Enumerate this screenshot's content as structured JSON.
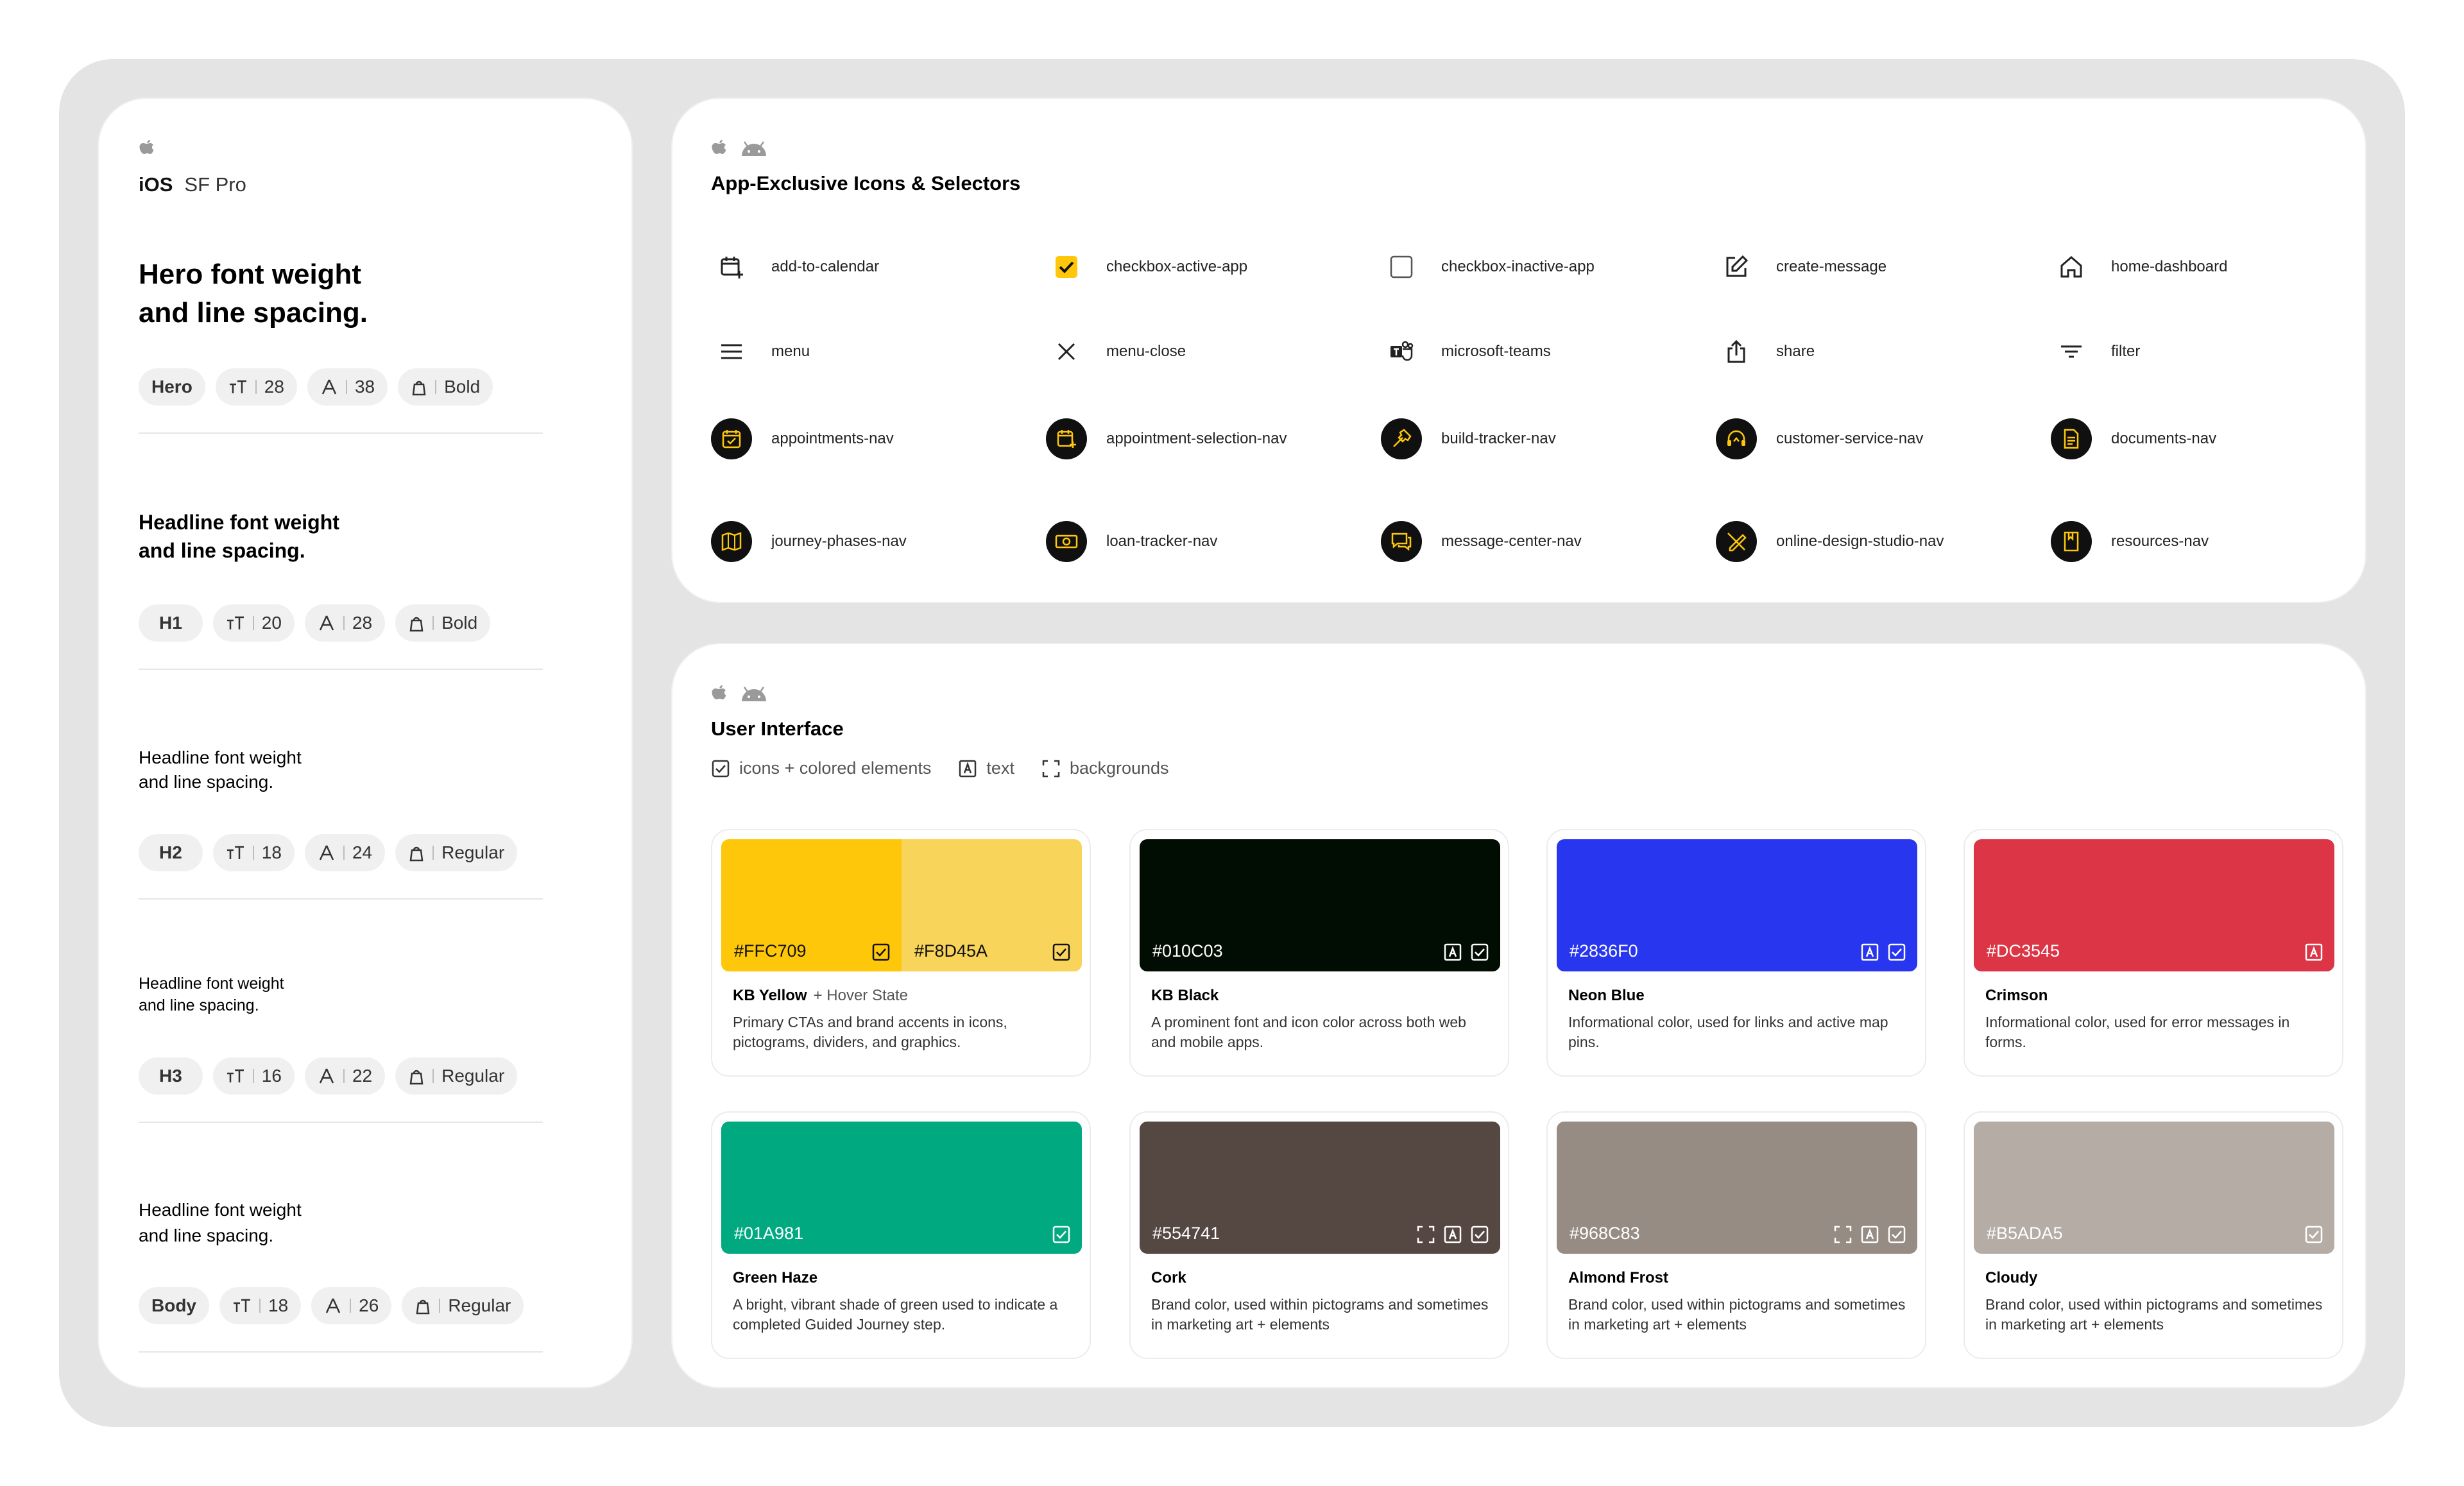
{
  "typography": {
    "platform_name": "iOS",
    "font_name": "SF Pro",
    "styles": [
      {
        "sample_line1": "Hero font weight",
        "sample_line2": "and line spacing.",
        "name": "Hero",
        "size": "28",
        "line_height": "38",
        "weight": "Bold"
      },
      {
        "sample_line1": "Headline font weight",
        "sample_line2": "and line spacing.",
        "name": "H1",
        "size": "20",
        "line_height": "28",
        "weight": "Bold"
      },
      {
        "sample_line1": "Headline font weight",
        "sample_line2": "and line spacing.",
        "name": "H2",
        "size": "18",
        "line_height": "24",
        "weight": "Regular"
      },
      {
        "sample_line1": "Headline font weight",
        "sample_line2": "and line spacing.",
        "name": "H3",
        "size": "16",
        "line_height": "22",
        "weight": "Regular"
      },
      {
        "sample_line1": "Headline font weight",
        "sample_line2": "and line spacing.",
        "name": "Body",
        "size": "18",
        "line_height": "26",
        "weight": "Regular"
      }
    ]
  },
  "icons_section": {
    "title": "App-Exclusive Icons & Selectors",
    "icons": [
      {
        "label": "add-to-calendar",
        "icon": "calendar-add-icon"
      },
      {
        "label": "checkbox-active-app",
        "icon": "checkbox-checked-icon"
      },
      {
        "label": "checkbox-inactive-app",
        "icon": "checkbox-empty-icon"
      },
      {
        "label": "create-message",
        "icon": "edit-icon"
      },
      {
        "label": "home-dashboard",
        "icon": "home-icon"
      },
      {
        "label": "menu",
        "icon": "menu-icon"
      },
      {
        "label": "menu-close",
        "icon": "close-icon"
      },
      {
        "label": "microsoft-teams",
        "icon": "teams-icon"
      },
      {
        "label": "share",
        "icon": "share-icon"
      },
      {
        "label": "filter",
        "icon": "filter-icon"
      },
      {
        "label": "appointments-nav",
        "icon": "calendar-check-icon"
      },
      {
        "label": "appointment-selection-nav",
        "icon": "calendar-add-icon"
      },
      {
        "label": "build-tracker-nav",
        "icon": "hammer-icon"
      },
      {
        "label": "customer-service-nav",
        "icon": "headset-icon"
      },
      {
        "label": "documents-nav",
        "icon": "document-icon"
      },
      {
        "label": "journey-phases-nav",
        "icon": "map-icon"
      },
      {
        "label": "loan-tracker-nav",
        "icon": "money-icon"
      },
      {
        "label": "message-center-nav",
        "icon": "chat-icon"
      },
      {
        "label": "online-design-studio-nav",
        "icon": "design-tools-icon"
      },
      {
        "label": "resources-nav",
        "icon": "book-icon"
      }
    ]
  },
  "ui_section": {
    "title": "User Interface",
    "legend": {
      "icons": "icons + colored elements",
      "text": "text",
      "backgrounds": "backgrounds"
    },
    "colors": [
      {
        "name": "KB Yellow",
        "sub": "+ Hover State",
        "hex": "#FFC709",
        "hex2": "#F8D45A",
        "desc": "Primary CTAs and brand accents in icons, pictograms, dividers, and graphics."
      },
      {
        "name": "KB Black",
        "sub": "",
        "hex": "#010C03",
        "desc": "A prominent font and icon color across both web and mobile apps."
      },
      {
        "name": "Neon Blue",
        "sub": "",
        "hex": "#2836F0",
        "desc": "Informational color, used for links and active map pins."
      },
      {
        "name": "Crimson",
        "sub": "",
        "hex": "#DC3545",
        "desc": "Informational color, used for error messages in forms."
      },
      {
        "name": "Green Haze",
        "sub": "",
        "hex": "#01A981",
        "desc": "A bright, vibrant shade of green used to indicate a completed Guided Journey step."
      },
      {
        "name": "Cork",
        "sub": "",
        "hex": "#554741",
        "desc": "Brand color, used within pictograms and sometimes in marketing art + elements"
      },
      {
        "name": "Almond Frost",
        "sub": "",
        "hex": "#968C83",
        "desc": "Brand color, used within pictograms and sometimes in marketing art + elements"
      },
      {
        "name": "Cloudy",
        "sub": "",
        "hex": "#B5ADA5",
        "desc": "Brand color, used within pictograms and sometimes in marketing art + elements"
      }
    ]
  },
  "colors": {
    "accent": "#FFC709",
    "panel_bg": "#FFFFFF",
    "frame_bg": "#E4E4E4"
  }
}
